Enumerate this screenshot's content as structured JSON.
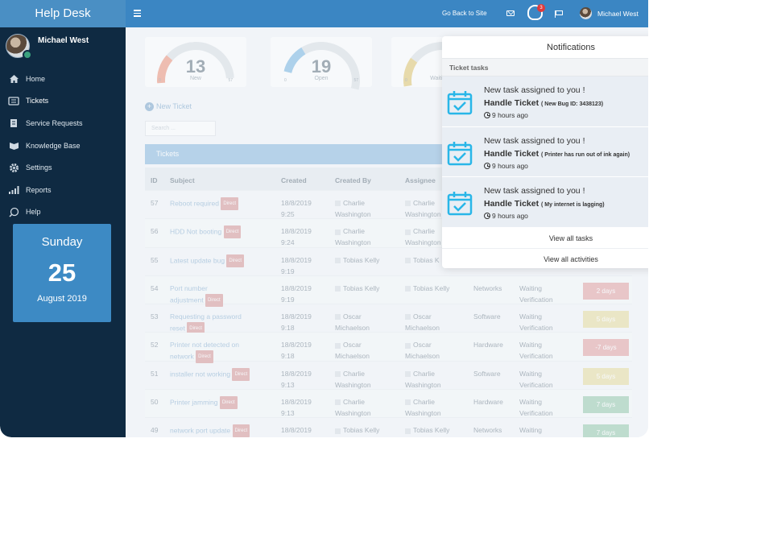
{
  "app": {
    "brand": "Help Desk"
  },
  "sidebar": {
    "user_name": "Michael West",
    "items": [
      {
        "label": "Home",
        "icon": "home-icon"
      },
      {
        "label": "Tickets",
        "icon": "ticket-icon"
      },
      {
        "label": "Service Requests",
        "icon": "document-icon"
      },
      {
        "label": "Knowledge Base",
        "icon": "book-icon"
      },
      {
        "label": "Settings",
        "icon": "gear-icon"
      },
      {
        "label": "Reports",
        "icon": "bar-chart-icon"
      },
      {
        "label": "Help",
        "icon": "help-icon"
      }
    ],
    "date_card": {
      "weekday": "Sunday",
      "day": "25",
      "month_year": "August 2019"
    }
  },
  "topbar": {
    "go_back": "Go Back to Site",
    "notification_count": "3",
    "user_name": "Michael West"
  },
  "gauges": [
    {
      "value": "13",
      "label": "New",
      "min": "0",
      "max": "57",
      "color": "#f2a38e",
      "fraction": 0.23
    },
    {
      "value": "19",
      "label": "Open",
      "min": "0",
      "max": "57",
      "color": "#8ec2e6",
      "fraction": 0.33
    },
    {
      "value": "",
      "label": "Waiting V",
      "min": "0",
      "max": "",
      "color": "#e6cf85",
      "fraction": 0.2
    }
  ],
  "main": {
    "new_ticket": "New Ticket",
    "search_placeholder": "Search ...",
    "tickets_heading": "Tickets",
    "columns": {
      "id": "ID",
      "subject": "Subject",
      "created": "Created",
      "created_by": "Created By",
      "assignee": "Assignee"
    },
    "direct_label": "Direct",
    "rows": [
      {
        "id": "57",
        "subject": "Reboot required",
        "created": "18/8/2019",
        "time": "9:25",
        "by": "Charlie",
        "by2": "Washington",
        "asg": "Charlie",
        "asg2": "Washington",
        "cat": "",
        "stat": "",
        "stat2": "",
        "due": "",
        "due_color": ""
      },
      {
        "id": "56",
        "subject": "HDD Not booting",
        "created": "18/8/2019",
        "time": "9:24",
        "by": "Charlie",
        "by2": "Washington",
        "asg": "Charlie",
        "asg2": "Washington",
        "cat": "",
        "stat": "",
        "stat2": "",
        "due": "",
        "due_color": ""
      },
      {
        "id": "55",
        "subject": "Latest update bug",
        "created": "18/8/2019",
        "time": "9:19",
        "by": "Tobias Kelly",
        "by2": "",
        "asg": "Tobias K",
        "asg2": "",
        "cat": "",
        "stat": "",
        "stat2": "Verification",
        "due": "",
        "due_color": ""
      },
      {
        "id": "54",
        "subject": "Port number",
        "subject2": "adjustment",
        "created": "18/8/2019",
        "time": "9:19",
        "by": "Tobias Kelly",
        "by2": "",
        "asg": "Tobias Kelly",
        "asg2": "",
        "cat": "Networks",
        "stat": "Waiting",
        "stat2": "Verification",
        "due": "2 days",
        "due_color": "red"
      },
      {
        "id": "53",
        "subject": "Requesting a password",
        "subject2": "reset",
        "created": "18/8/2019",
        "time": "9:18",
        "by": "Oscar",
        "by2": "Michaelson",
        "asg": "Oscar",
        "asg2": "Michaelson",
        "cat": "Software",
        "stat": "Waiting",
        "stat2": "Verification",
        "due": "5 days",
        "due_color": "yellow"
      },
      {
        "id": "52",
        "subject": "Printer not detected on",
        "subject2": "network",
        "created": "18/8/2019",
        "time": "9:18",
        "by": "Oscar",
        "by2": "Michaelson",
        "asg": "Oscar",
        "asg2": "Michaelson",
        "cat": "Hardware",
        "stat": "Waiting",
        "stat2": "Verification",
        "due": "-7 days",
        "due_color": "red"
      },
      {
        "id": "51",
        "subject": "installer not working",
        "created": "18/8/2019",
        "time": "9:13",
        "by": "Charlie",
        "by2": "Washington",
        "asg": "Charlie",
        "asg2": "Washington",
        "cat": "Software",
        "stat": "Waiting",
        "stat2": "Verification",
        "due": "5 days",
        "due_color": "yellow"
      },
      {
        "id": "50",
        "subject": "Printer jamming",
        "created": "18/8/2019",
        "time": "9:13",
        "by": "Charlie",
        "by2": "Washington",
        "asg": "Charlie",
        "asg2": "Washington",
        "cat": "Hardware",
        "stat": "Waiting",
        "stat2": "Verification",
        "due": "7 days",
        "due_color": "green"
      },
      {
        "id": "49",
        "subject": "network port update",
        "created": "18/8/2019",
        "time": "",
        "by": "Tobias Kelly",
        "by2": "",
        "asg": "Tobias Kelly",
        "asg2": "",
        "cat": "Networks",
        "stat": "Waiting",
        "stat2": "",
        "due": "7 days",
        "due_color": "green"
      }
    ]
  },
  "notifications": {
    "title": "Notifications",
    "section": "Ticket tasks",
    "tasks": [
      {
        "heading": "New task assigned to you !",
        "title": "Handle Ticket",
        "detail": "( New Bug ID: 3438123)",
        "time": "9 hours ago"
      },
      {
        "heading": "New task assigned to you !",
        "title": "Handle Ticket",
        "detail": "( Printer has run out of ink again)",
        "time": "9 hours ago"
      },
      {
        "heading": "New task assigned to you !",
        "title": "Handle Ticket",
        "detail": "( My internet is lagging)",
        "time": "9 hours ago"
      }
    ],
    "view_tasks": "View all tasks",
    "view_activities": "View all activities"
  },
  "colors": {
    "sidebar": "#0f2a42",
    "topbar": "#3b86c3",
    "accent": "#3d8ac4",
    "calendar_icon": "#29b6e8"
  }
}
